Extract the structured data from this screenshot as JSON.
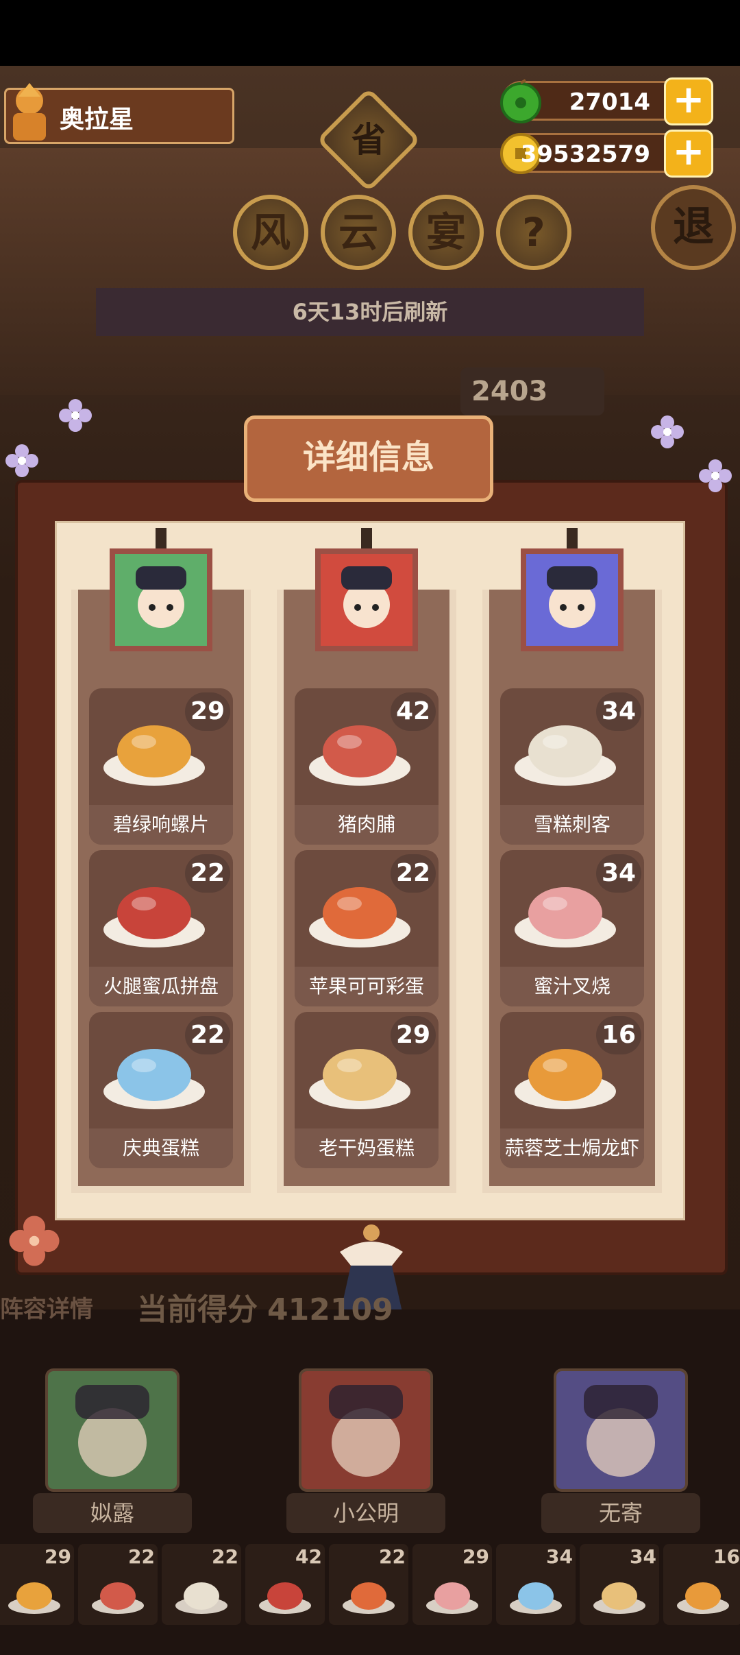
{
  "profile": {
    "name": "奥拉星"
  },
  "currency": {
    "jade": "27014",
    "coins": "39532579"
  },
  "event": {
    "badge": "省",
    "title": [
      "风",
      "云",
      "宴"
    ],
    "help": "?",
    "refresh": "6天13时后刷新",
    "score_partial": "2403"
  },
  "exit_button": "退",
  "dialog": {
    "title": "详细信息",
    "columns": [
      {
        "dishes": [
          {
            "name": "碧绿响螺片",
            "level": "29",
            "icon": "conch-slice-dish"
          },
          {
            "name": "火腿蜜瓜拼盘",
            "level": "22",
            "icon": "ham-melon-platter"
          },
          {
            "name": "庆典蛋糕",
            "level": "22",
            "icon": "celebration-cake"
          }
        ]
      },
      {
        "dishes": [
          {
            "name": "猪肉脯",
            "level": "42",
            "icon": "pork-jerky"
          },
          {
            "name": "苹果可可彩蛋",
            "level": "22",
            "icon": "apple-cocoa-egg"
          },
          {
            "name": "老干妈蛋糕",
            "level": "29",
            "icon": "chili-sauce-cake"
          }
        ]
      },
      {
        "dishes": [
          {
            "name": "雪糕刺客",
            "level": "34",
            "icon": "ice-cream-bar"
          },
          {
            "name": "蜜汁叉烧",
            "level": "34",
            "icon": "char-siu"
          },
          {
            "name": "蒜蓉芝士焗龙虾",
            "level": "16",
            "icon": "baked-lobster"
          }
        ]
      }
    ]
  },
  "bottom": {
    "lineup_label": "阵容详情",
    "score_label": "当前得分",
    "score_value": "412109",
    "heroes": [
      "姒露",
      "小公明",
      "无寄"
    ],
    "mini_dishes": [
      "29",
      "22",
      "22",
      "42",
      "22",
      "29",
      "34",
      "34",
      "16"
    ]
  },
  "colors": {
    "accent": "#f3b21a",
    "panel": "#5c2a1c",
    "card": "#8f6a58"
  }
}
